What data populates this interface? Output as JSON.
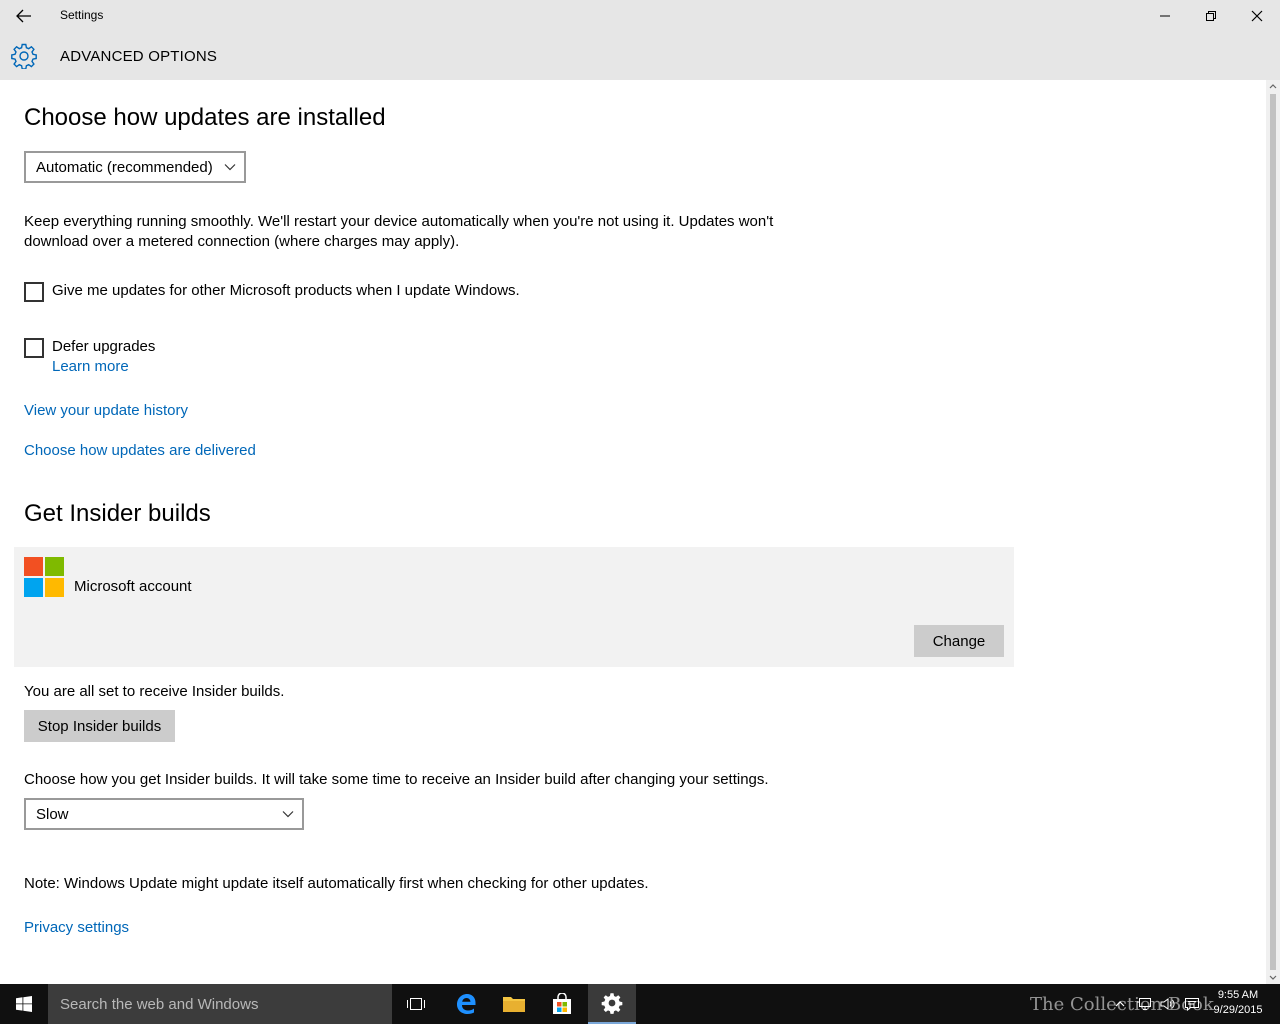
{
  "window": {
    "app_title": "Settings",
    "page_title": "ADVANCED OPTIONS"
  },
  "updates": {
    "heading": "Choose how updates are installed",
    "install_mode": "Automatic (recommended)",
    "description_line1": "Keep everything running smoothly. We'll restart your device automatically when you're not using it. Updates won't",
    "description_line2": "download over a metered connection (where charges may apply).",
    "other_products_label": "Give me updates for other Microsoft products when I update Windows.",
    "other_products_checked": false,
    "defer_label": "Defer upgrades",
    "defer_checked": false,
    "learn_more": "Learn more",
    "history_link": "View your update history",
    "delivery_link": "Choose how updates are delivered"
  },
  "insider": {
    "heading": "Get Insider builds",
    "account_label": "Microsoft account",
    "change_button": "Change",
    "status": "You are all set to receive Insider builds.",
    "stop_button": "Stop Insider builds",
    "ring_description": "Choose how you get Insider builds. It will take some time to receive an Insider build after changing your settings.",
    "ring_value": "Slow"
  },
  "footer": {
    "note": "Note: Windows Update might update itself automatically first when checking for other updates.",
    "privacy_link": "Privacy settings"
  },
  "taskbar": {
    "search_placeholder": "Search the web and Windows",
    "time": "9:55 AM",
    "date": "9/29/2015",
    "watermark": "The Collection Book"
  },
  "colors": {
    "accent": "#0067b8",
    "chrome": "#e6e6e6",
    "taskbar": "#101010",
    "ms_red": "#f25022",
    "ms_green": "#7fba00",
    "ms_blue": "#00a4ef",
    "ms_yellow": "#ffb900"
  }
}
